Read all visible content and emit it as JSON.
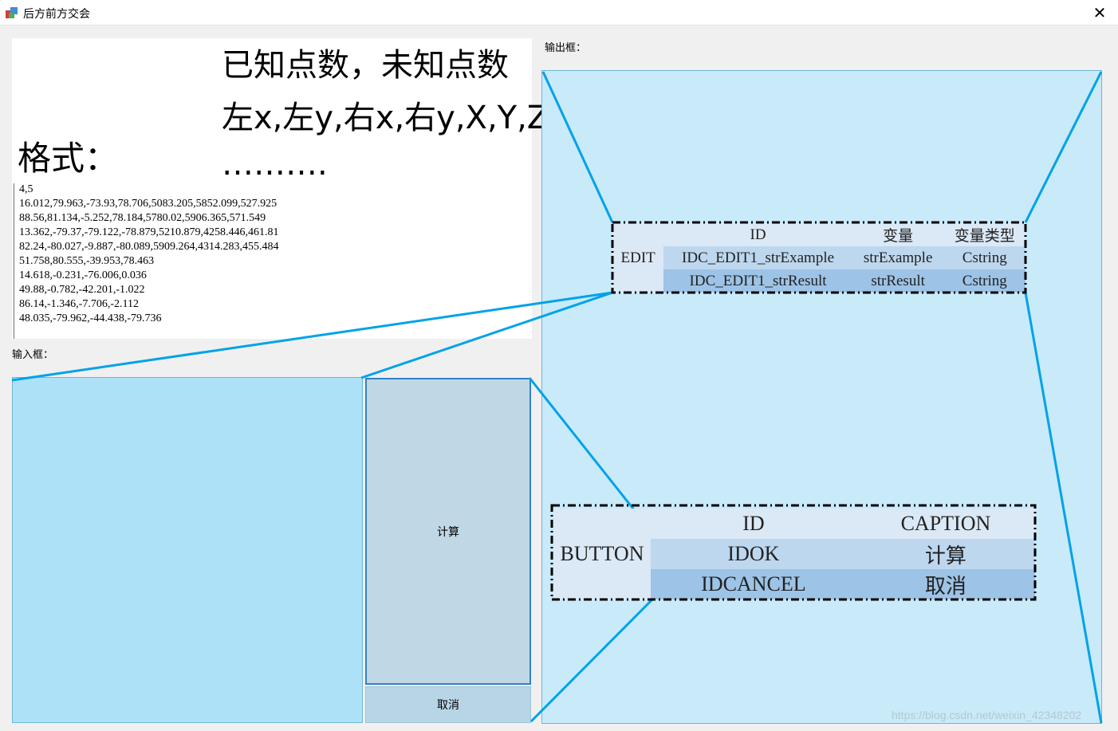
{
  "window": {
    "title": "后方前方交会",
    "close_glyph": "✕"
  },
  "format_panel": {
    "heading": "格式：",
    "line1": "已知点数，未知点数",
    "line2": "左x,左y,右x,右y,X,Y,Z",
    "line3": "……….",
    "data_lines": [
      "4,5",
      "16.012,79.963,-73.93,78.706,5083.205,5852.099,527.925",
      "88.56,81.134,-5.252,78.184,5780.02,5906.365,571.549",
      "13.362,-79.37,-79.122,-78.879,5210.879,4258.446,461.81",
      "82.24,-80.027,-9.887,-80.089,5909.264,4314.283,455.484",
      "51.758,80.555,-39.953,78.463",
      "14.618,-0.231,-76.006,0.036",
      "49.88,-0.782,-42.201,-1.022",
      "86.14,-1.346,-7.706,-2.112",
      "48.035,-79.962,-44.438,-79.736"
    ]
  },
  "input_label": "输入框：",
  "output_label": "输出框：",
  "buttons": {
    "calc": "计算",
    "cancel": "取消"
  },
  "edit_table": {
    "type_label": "EDIT",
    "headers": [
      "ID",
      "变量",
      "变量类型"
    ],
    "rows": [
      [
        "IDC_EDIT1_strExample",
        "strExample",
        "Cstring"
      ],
      [
        "IDC_EDIT1_strResult",
        "strResult",
        "Cstring"
      ]
    ]
  },
  "button_table": {
    "type_label": "BUTTON",
    "headers": [
      "ID",
      "CAPTION"
    ],
    "rows": [
      [
        "IDOK",
        "计算"
      ],
      [
        "IDCANCEL",
        "取消"
      ]
    ]
  },
  "watermark": "https://blog.csdn.net/weixin_42348202",
  "colors": {
    "annotation_line": "#00a2e8",
    "input_bg": "#ade1f8",
    "output_bg": "#c8eaf9"
  }
}
